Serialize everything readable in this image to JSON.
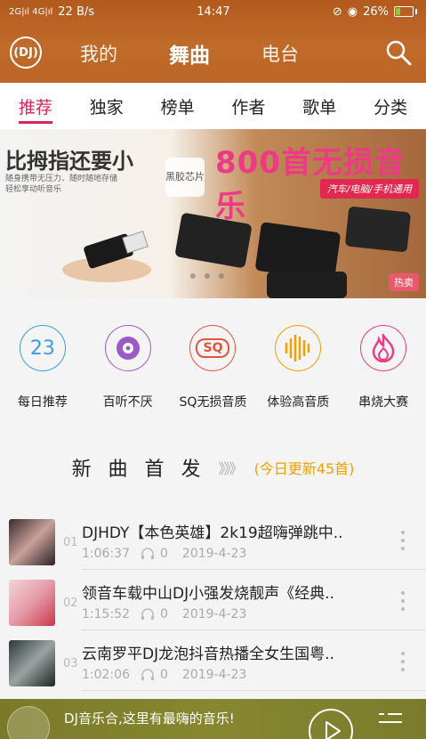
{
  "status_bar": {
    "network": "2G|ıl 4G|ıl",
    "speed": "22 B/s",
    "time": "14:47",
    "battery": "26%",
    "battery_level": 0.26
  },
  "nav": {
    "tabs": [
      "我的",
      "舞曲",
      "电台"
    ],
    "active": 1,
    "logo": "DJ"
  },
  "subtabs": [
    "推荐",
    "独家",
    "榜单",
    "作者",
    "歌单",
    "分类"
  ],
  "banner": {
    "left_title": "比拇指还要小",
    "left_sub1": "随身携带无压力、随时随地存储",
    "left_sub2": "轻松享动听音乐",
    "badge": "黑胶芯片",
    "headline": "800首无损音乐",
    "tag": "汽车/电脑/手机通用",
    "hot": "热卖"
  },
  "features": [
    {
      "label": "每日推荐",
      "icon_text": "23",
      "color": "#3f9ae0",
      "icon": "calendar-icon"
    },
    {
      "label": "百听不厌",
      "icon_text": "",
      "color": "#9a5ac8",
      "icon": "disc-icon"
    },
    {
      "label": "SQ无损音质",
      "icon_text": "SQ",
      "color": "#e5533a",
      "icon": "sq-icon"
    },
    {
      "label": "体验高音质",
      "icon_text": "",
      "color": "#f0a000",
      "icon": "waveform-icon"
    },
    {
      "label": "串烧大赛",
      "icon_text": "",
      "color": "#ee3a86",
      "icon": "flame-icon"
    }
  ],
  "new_section": {
    "title": "新 曲 首 发",
    "arrows": "》》》",
    "update": "(今日更新45首)"
  },
  "songs": [
    {
      "num": "01",
      "title": "DJHDY【本色英雄】2k19超嗨弹跳中..",
      "duration": "1:06:37",
      "plays": "0",
      "date": "2019-4-23"
    },
    {
      "num": "02",
      "title": "领音车载中山DJ小强发烧靓声《经典..",
      "duration": "1:15:52",
      "plays": "0",
      "date": "2019-4-23"
    },
    {
      "num": "03",
      "title": "云南罗平DJ龙泡抖音热播全女生国粤..",
      "duration": "1:02:06",
      "plays": "0",
      "date": "2019-4-23"
    }
  ],
  "player": {
    "text": "DJ音乐合,这里有最嗨的音乐!"
  }
}
